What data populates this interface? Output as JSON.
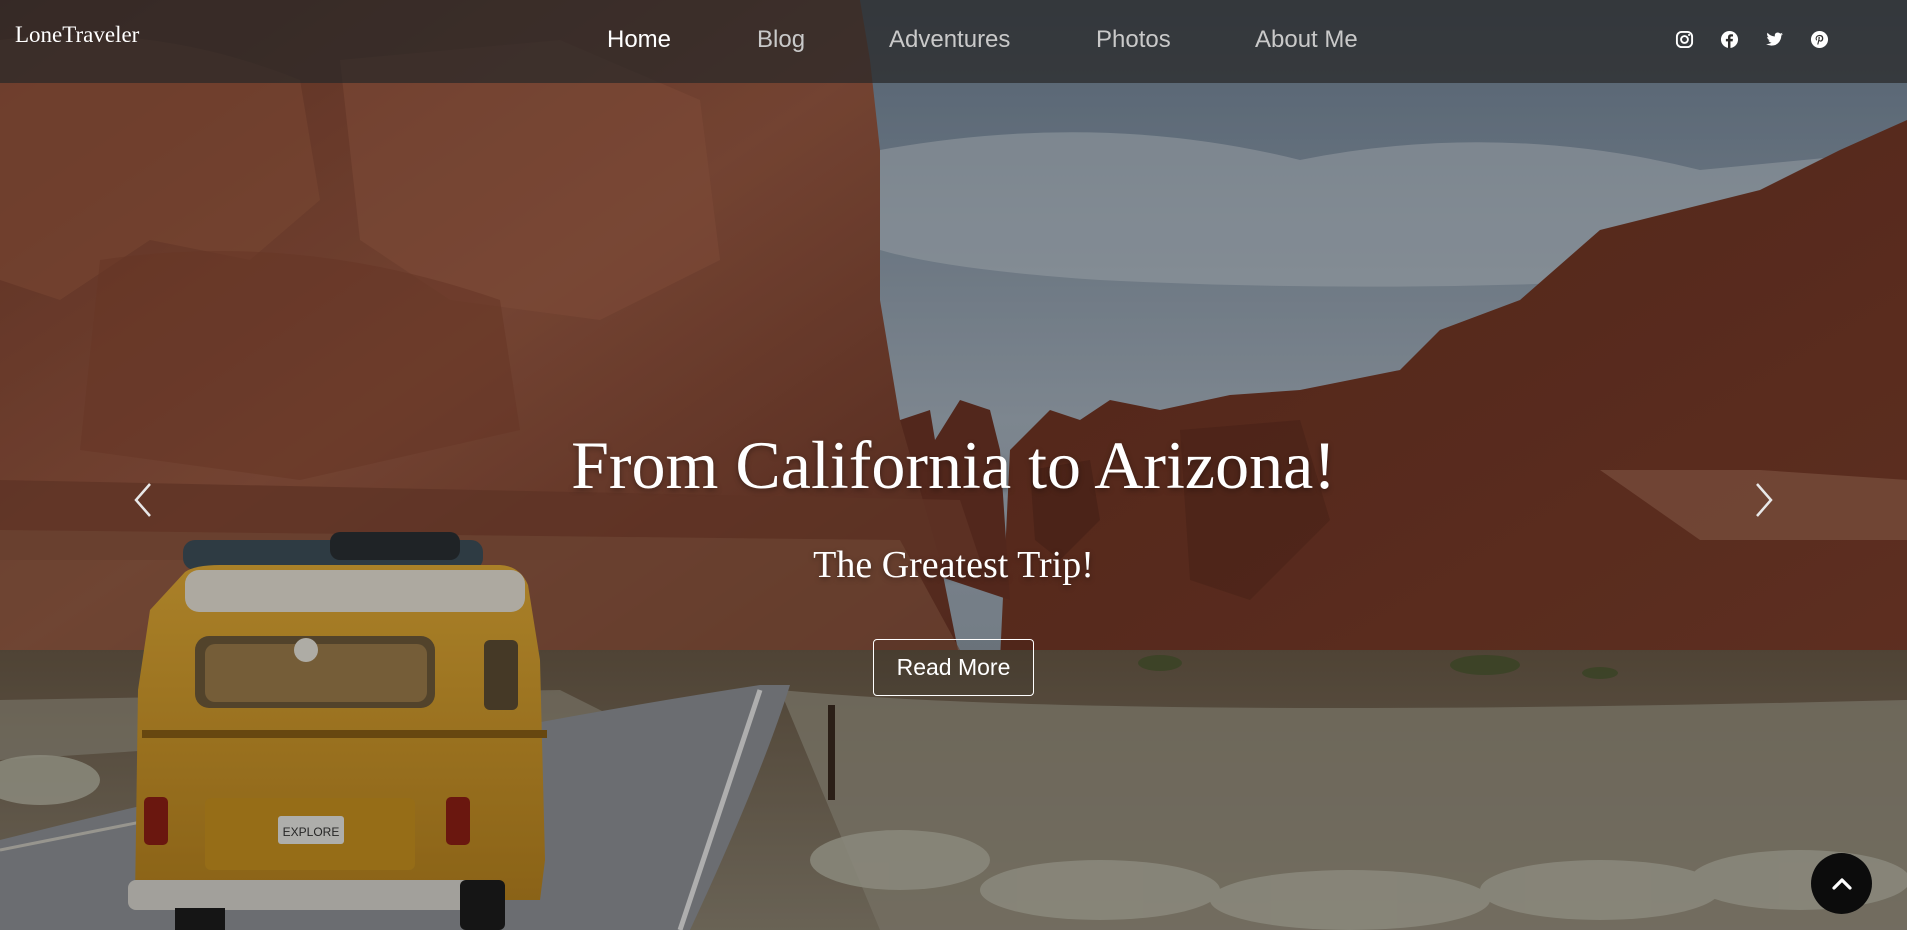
{
  "brand": "LoneTraveler",
  "nav": {
    "items": [
      {
        "label": "Home",
        "active": true
      },
      {
        "label": "Blog",
        "active": false
      },
      {
        "label": "Adventures",
        "active": false
      },
      {
        "label": "Photos",
        "active": false
      },
      {
        "label": "About Me",
        "active": false
      }
    ]
  },
  "social": [
    "instagram-icon",
    "facebook-icon",
    "twitter-icon",
    "pinterest-icon"
  ],
  "hero": {
    "title": "From California to Arizona!",
    "subtitle": "The Greatest Trip!",
    "button_label": "Read More",
    "license_plate": "EXPLORE"
  },
  "colors": {
    "navbar": "#2c2c2c",
    "nav_active": "#ffffff",
    "nav_inactive": "#c9c9c9",
    "van": "#d9a22e",
    "rock": "#8a4a35",
    "back_to_top": "#0c0c0c"
  }
}
